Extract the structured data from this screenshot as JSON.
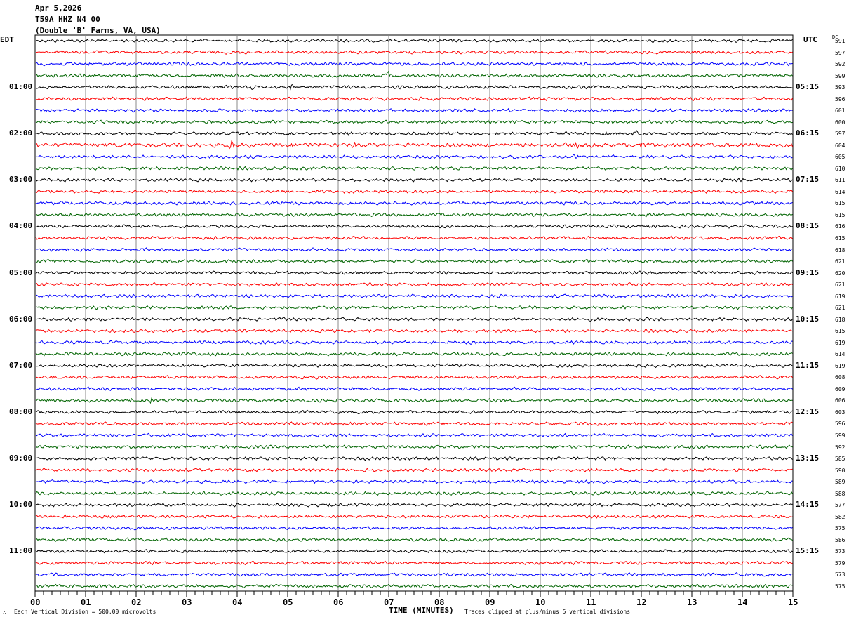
{
  "header": {
    "date": "Apr 5,2026",
    "station": "T59A HHZ N4 00",
    "location": "(Double 'B' Farms, VA, USA)"
  },
  "left_timezone": "EDT",
  "right_timezone": "UTC",
  "dc_label": "DC",
  "footer": {
    "scale": "Each Vertical Division =  500.00 microvolts",
    "xlabel": "TIME (MINUTES)",
    "clip_note": "Traces clipped at plus/minus 5 vertical divisions",
    "corner_mark": "∴"
  },
  "chart_data": {
    "type": "line",
    "title": "T59A HHZ N4 00",
    "xlabel": "TIME (MINUTES)",
    "xlim": [
      0,
      15
    ],
    "x_ticks": [
      "00",
      "01",
      "02",
      "03",
      "04",
      "05",
      "06",
      "07",
      "08",
      "09",
      "10",
      "11",
      "12",
      "13",
      "14",
      "15"
    ],
    "grid": "vertical every minute",
    "trace_colors": [
      "#000000",
      "#ff0000",
      "#0000ff",
      "#006400"
    ],
    "left_hour_labels": [
      "01:00",
      "02:00",
      "03:00",
      "04:00",
      "05:00",
      "06:00",
      "07:00",
      "08:00",
      "09:00",
      "10:00",
      "11:00"
    ],
    "right_hour_labels": [
      "05:15",
      "06:15",
      "07:15",
      "08:15",
      "09:15",
      "10:15",
      "11:15",
      "12:15",
      "13:15",
      "14:15",
      "15:15"
    ],
    "dc_values": [
      591,
      597,
      592,
      599,
      593,
      596,
      601,
      600,
      597,
      604,
      605,
      610,
      611,
      614,
      615,
      615,
      616,
      615,
      618,
      621,
      620,
      621,
      619,
      621,
      618,
      615,
      619,
      614,
      619,
      608,
      609,
      606,
      603,
      596,
      599,
      592,
      585,
      590,
      589,
      588,
      577,
      582,
      575,
      586,
      573,
      579,
      573,
      575
    ]
  }
}
